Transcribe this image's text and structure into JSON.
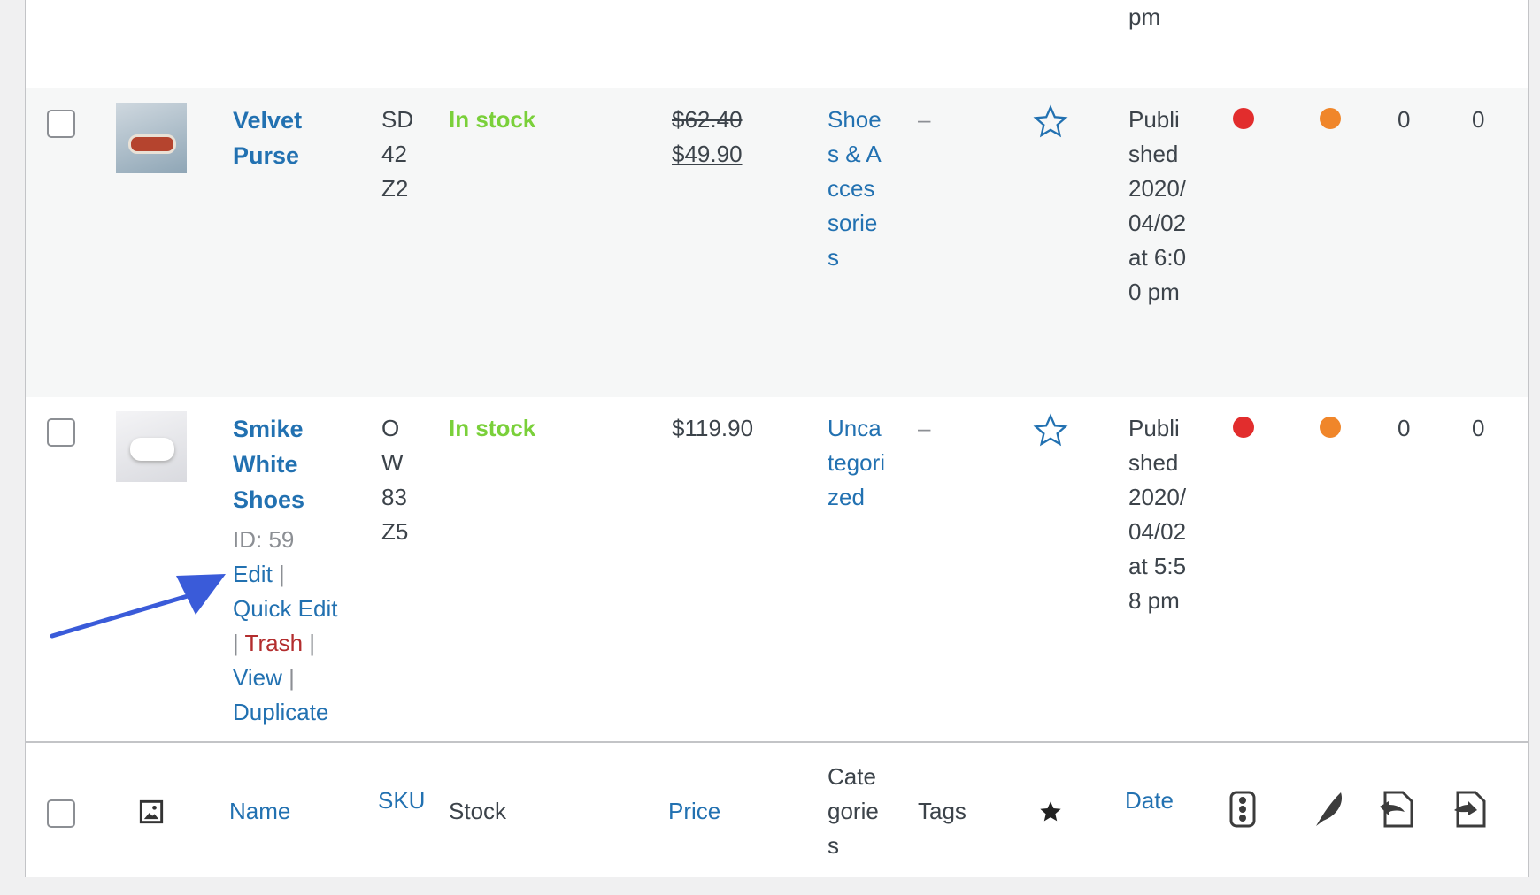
{
  "rows_above": {
    "date_tail": "pm"
  },
  "products": [
    {
      "name": "Velvet Purse",
      "sku": "SD42Z2",
      "stock": "In stock",
      "price_regular": "$62.40",
      "price_sale": "$49.90",
      "categories": "Shoes & Accessories",
      "tags": "–",
      "date": "Published 2020/04/02 at 6:00 pm",
      "count1": "0",
      "count2": "0"
    },
    {
      "name": "Smike White Shoes",
      "sku": "OW83Z5",
      "stock": "In stock",
      "price": "$119.90",
      "categories": "Uncategorized",
      "tags": "–",
      "date": "Published 2020/04/02 at 5:58 pm",
      "count1": "0",
      "count2": "0",
      "row_actions": {
        "id": "ID: 59",
        "edit": "Edit",
        "quick_edit": "Quick Edit",
        "trash": "Trash",
        "view": "View",
        "duplicate": "Duplicate"
      }
    }
  ],
  "footer": {
    "name": "Name",
    "sku": "SKU",
    "stock": "Stock",
    "price": "Price",
    "categories": "Categories",
    "tags": "Tags",
    "date": "Date"
  },
  "colors": {
    "link": "#2271b1",
    "in_stock": "#7ad03a",
    "red_dot": "#e22d2d",
    "orange_dot": "#f0862a",
    "annotation_arrow": "#3a5bd9",
    "trash": "#b32d2e"
  },
  "icons": [
    "image-icon",
    "star-icon",
    "traffic-light-icon",
    "feather-icon",
    "file-import-icon",
    "file-export-icon"
  ]
}
